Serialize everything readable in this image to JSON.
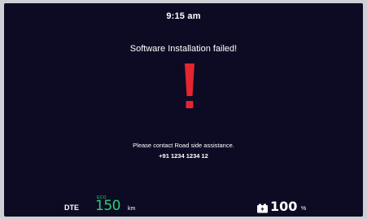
{
  "status_bar": {
    "time": "9:15 am"
  },
  "alert": {
    "title": "Software Installation failed!",
    "icon": "exclamation-icon",
    "icon_color": "#e3262f",
    "message": "Please contact Road side assistance.",
    "phone": "+91 1234 1234 12"
  },
  "footer": {
    "dte_label": "DTE",
    "mode_label": "ECO",
    "range_value": "150",
    "range_unit": "km",
    "range_color": "#2ecf72",
    "battery_icon": "battery-icon",
    "battery_value": "100",
    "battery_unit": "%"
  },
  "colors": {
    "background": "#0d0b24",
    "text": "#ffffff"
  }
}
